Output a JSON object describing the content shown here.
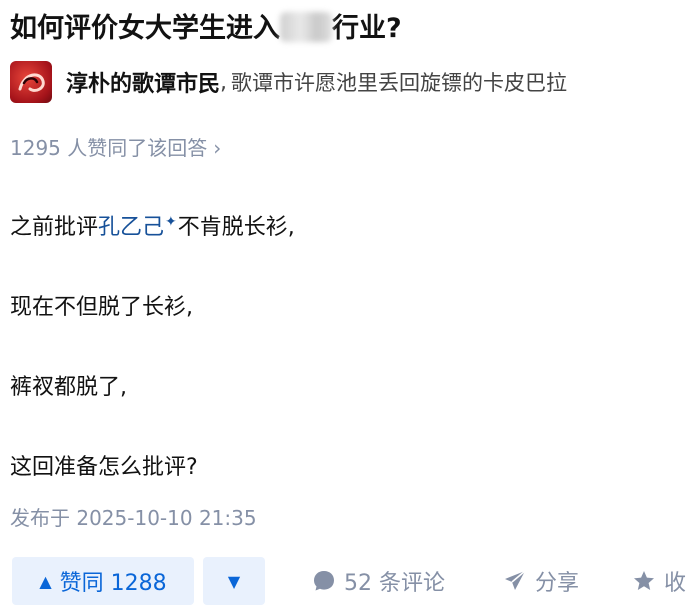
{
  "question": {
    "title_before": "如何评价女大学生进入",
    "title_after": "行业?"
  },
  "author": {
    "name": "淳朴的歌谭市民",
    "separator": ",",
    "bio": "歌谭市许愿池里丢回旋镖的卡皮巴拉"
  },
  "answer": {
    "votes_summary": "1295 人赞同了该回答",
    "votes_chevron": "›",
    "line1_before": "之前批评",
    "line1_link": "孔乙己",
    "line1_sparkle": "✦",
    "line1_after": "不肯脱长衫,",
    "line2": "现在不但脱了长衫,",
    "line3": "裤衩都脱了,",
    "line4": "这回准备怎么批评?",
    "publish_time": "发布于 2025-10-10 21:35"
  },
  "actions": {
    "upvote_arrow": "▲",
    "upvote_label": "赞同 1288",
    "downvote_arrow": "▼",
    "comments_label": "52 条评论",
    "share_label": "分享",
    "collect_label": "收"
  },
  "colors": {
    "link": "#175199",
    "meta_gray": "#8590a6",
    "vote_bg": "#e9f1fd",
    "vote_text": "#0a66d8"
  }
}
